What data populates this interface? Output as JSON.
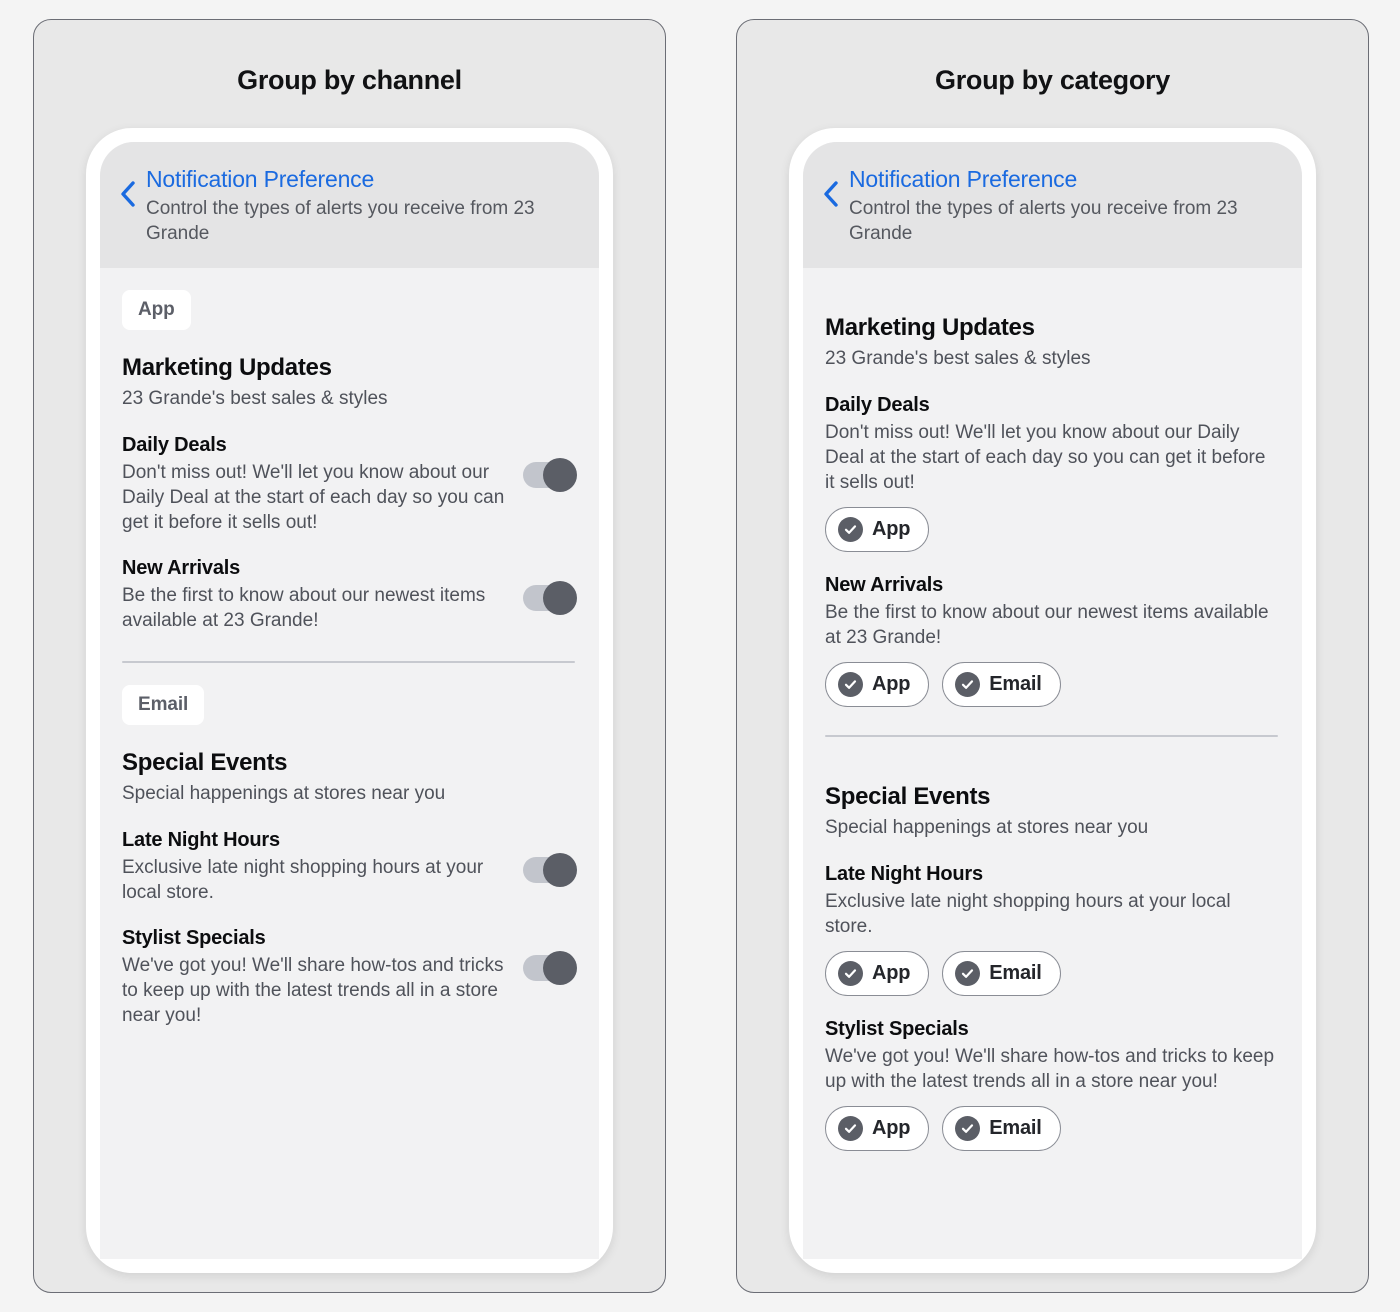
{
  "colors": {
    "page_bg": "#f4f4f4",
    "card_bg": "#e8e8e8",
    "card_border": "#6b6d75",
    "screen_bg": "#f2f2f3",
    "header_bg": "#e4e4e5",
    "link_blue": "#1a6ae0",
    "toggle_track": "#c2c5cc",
    "toggle_knob": "#5b5e66",
    "chip_border": "#8a8d95",
    "text_dark": "#0c0d0f",
    "text_muted": "#4f525a"
  },
  "icons": {
    "back": "chevron-left-icon",
    "check": "check-circle-icon"
  },
  "panels": [
    {
      "variant_title": "Group by channel",
      "header": {
        "title": "Notification Preference",
        "subtitle": "Control the types of alerts you receive from 23 Grande",
        "back_label": "Back"
      },
      "sections": [
        {
          "channel_badge": "App",
          "group_title": "Marketing Updates",
          "group_sub": "23 Grande's best sales & styles",
          "prefs": [
            {
              "title": "Daily Deals",
              "desc": "Don't miss out! We'll let you know about our Daily Deal at the start of each day so you can get it before it sells out!",
              "toggle_on": true
            },
            {
              "title": "New Arrivals",
              "desc": "Be the first to know about our newest items available at 23 Grande!",
              "toggle_on": true
            }
          ]
        },
        {
          "channel_badge": "Email",
          "group_title": "Special Events",
          "group_sub": "Special happenings at stores near you",
          "prefs": [
            {
              "title": "Late Night Hours",
              "desc": "Exclusive late night shopping hours at your local store.",
              "toggle_on": true
            },
            {
              "title": "Stylist Specials",
              "desc": "We've got you! We'll share how-tos and tricks to keep up with the latest trends all in a store near you!",
              "toggle_on": true
            }
          ]
        }
      ]
    },
    {
      "variant_title": "Group by category",
      "header": {
        "title": "Notification Preference",
        "subtitle": "Control the types of alerts you receive from 23 Grande",
        "back_label": "Back"
      },
      "sections": [
        {
          "group_title": "Marketing Updates",
          "group_sub": "23 Grande's best sales & styles",
          "prefs": [
            {
              "title": "Daily Deals",
              "desc": "Don't miss out! We'll let you know about our Daily Deal at the start of each day so you can get it before it sells out!",
              "chips": [
                "App"
              ]
            },
            {
              "title": "New Arrivals",
              "desc": "Be the first to know about our newest items available at 23 Grande!",
              "chips": [
                "App",
                "Email"
              ]
            }
          ]
        },
        {
          "group_title": "Special Events",
          "group_sub": "Special happenings at stores near you",
          "prefs": [
            {
              "title": "Late Night Hours",
              "desc": "Exclusive late night shopping hours at your local store.",
              "chips": [
                "App",
                "Email"
              ]
            },
            {
              "title": "Stylist Specials",
              "desc": "We've got you! We'll share how-tos and tricks to keep up with the latest trends all in a store near you!",
              "chips": [
                "App",
                "Email"
              ]
            }
          ]
        }
      ]
    }
  ]
}
